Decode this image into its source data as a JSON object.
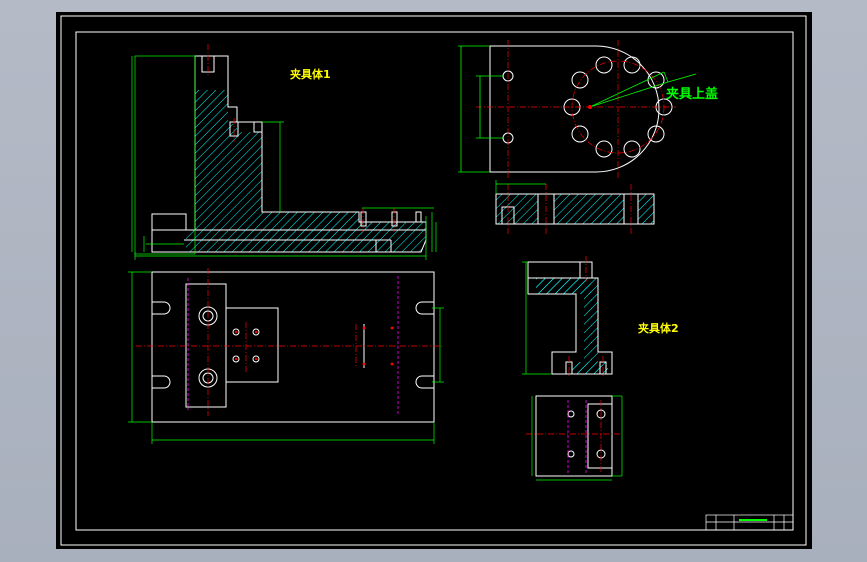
{
  "drawing": {
    "labels": {
      "fixture_body_1": "夹具体1",
      "fixture_top_cover": "夹具上盖",
      "fixture_body_2": "夹具体2"
    },
    "colors": {
      "background": "#000000",
      "outline": "#ffffff",
      "dimension": "#00ff00",
      "centerline": "#ff0000",
      "hatch": "#00ffff",
      "hidden": "#ff00ff",
      "label": "#ffff00"
    }
  }
}
